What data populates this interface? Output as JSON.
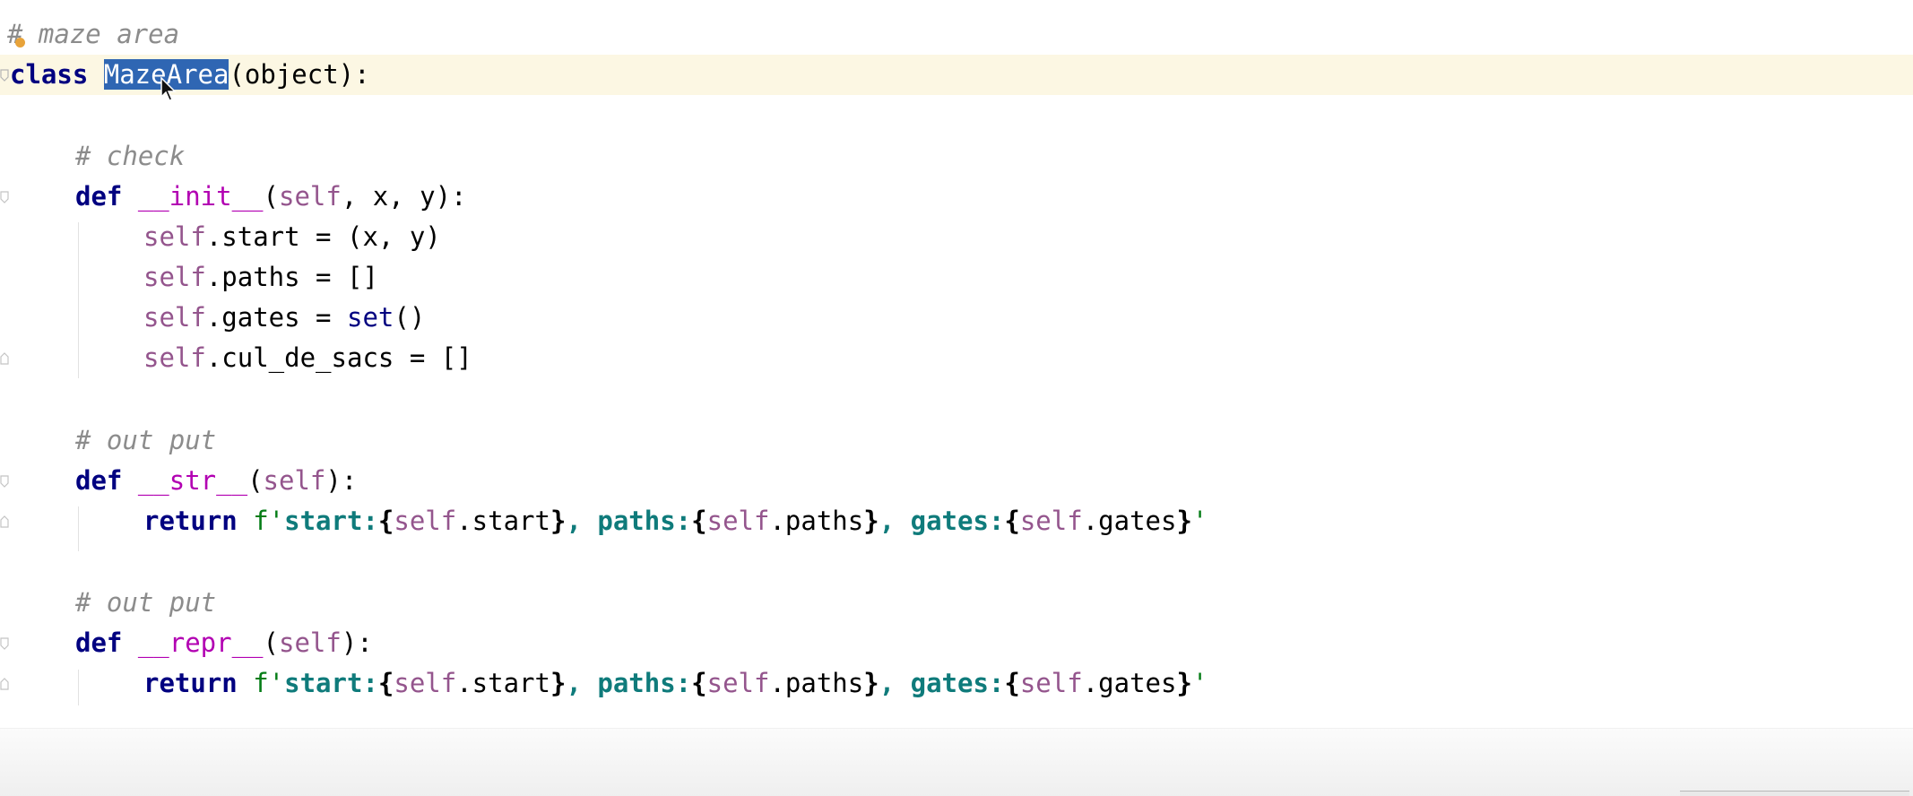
{
  "editor": {
    "language": "Python",
    "colors": {
      "background": "#ffffff",
      "current_line": "#fcf7e3",
      "comment": "#8c8c8c",
      "keyword": "#000080",
      "magic_method": "#b200b2",
      "self": "#94558d",
      "string": "#067d17",
      "fstring_key": "#0f7b7b",
      "selection": "#2f66b3"
    },
    "lines": {
      "l1": {
        "comment": "# maze area"
      },
      "l2": {
        "kw": "class ",
        "name": "MazeArea",
        "rest": "(object):"
      },
      "l4": {
        "comment": "# check"
      },
      "l5": {
        "kw": "def ",
        "fn": "__init__",
        "open": "(",
        "self": "self",
        "rest": ", x, y):"
      },
      "l6": {
        "self": "self",
        "rest": ".start = (x, y)"
      },
      "l7": {
        "self": "self",
        "rest": ".paths = []"
      },
      "l8": {
        "self": "self",
        "mid": ".gates = ",
        "builtin": "set",
        "rest": "()"
      },
      "l9": {
        "self": "self",
        "rest": ".cul_de_sacs = []"
      },
      "l11": {
        "comment": "# out put"
      },
      "l12": {
        "kw": "def ",
        "fn": "__str__",
        "open": "(",
        "self": "self",
        "rest": "):"
      },
      "l13": {
        "kw": "return ",
        "f_prefix": "f'",
        "key1": "start:",
        "obr1": "{",
        "self1": "self",
        "attr1": ".start",
        "cbr1": "}",
        "sep1": ", ",
        "key2": "paths:",
        "obr2": "{",
        "self2": "self",
        "attr2": ".paths",
        "cbr2": "}",
        "sep2": ", ",
        "key3": "gates:",
        "obr3": "{",
        "self3": "self",
        "attr3": ".gates",
        "cbr3": "}",
        "f_suffix": "'"
      },
      "l15": {
        "comment": "# out put"
      },
      "l16": {
        "kw": "def ",
        "fn": "__repr__",
        "open": "(",
        "self": "self",
        "rest": "):"
      },
      "l17": {
        "kw": "return ",
        "f_prefix": "f'",
        "key1": "start:",
        "obr1": "{",
        "self1": "self",
        "attr1": ".start",
        "cbr1": "}",
        "sep1": ", ",
        "key2": "paths:",
        "obr2": "{",
        "self2": "self",
        "attr2": ".paths",
        "cbr2": "}",
        "sep2": ", ",
        "key3": "gates:",
        "obr3": "{",
        "self3": "self",
        "attr3": ".gates",
        "cbr3": "}",
        "f_suffix": "'"
      }
    }
  }
}
